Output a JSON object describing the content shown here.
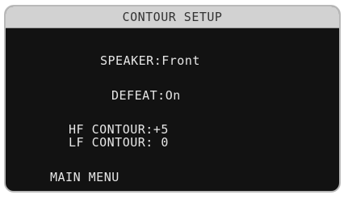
{
  "screen": {
    "title": "CONTOUR SETUP"
  },
  "settings": {
    "speaker": {
      "label": "SPEAKER:",
      "value": "Front"
    },
    "defeat": {
      "label": "DEFEAT:",
      "value": "On"
    },
    "hf_contour": {
      "label": "HF CONTOUR:",
      "value": "+5"
    },
    "lf_contour": {
      "label": "LF CONTOUR:",
      "value": " 0"
    }
  },
  "navigation": {
    "main_menu": "MAIN MENU"
  },
  "colors": {
    "background": "#121212",
    "title_bar": "#d2d2d2",
    "text": "#e6e6e6",
    "border": "#b9b9b9"
  }
}
